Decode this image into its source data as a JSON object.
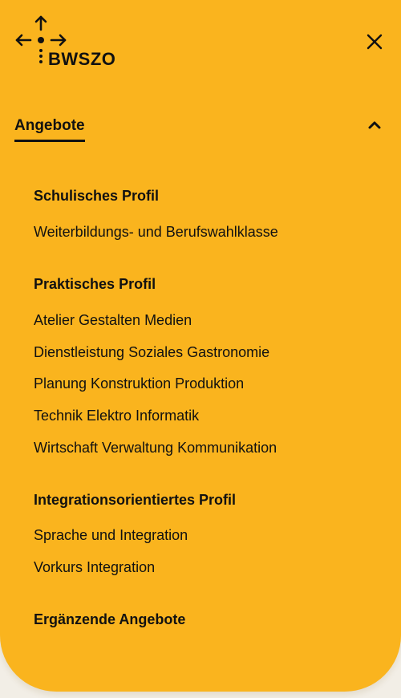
{
  "header": {
    "logo_text": "BWSZO"
  },
  "menu": {
    "section_title": "Angebote",
    "groups": [
      {
        "heading": "Schulisches Profil",
        "links": [
          "Weiterbildungs- und Berufswahlklasse"
        ]
      },
      {
        "heading": "Praktisches Profil",
        "links": [
          "Atelier Gestalten Medien",
          "Dienstleistung Soziales Gastronomie",
          "Planung Konstruktion Produktion",
          "Technik Elektro Informatik",
          "Wirtschaft Verwaltung Kommunikation"
        ]
      },
      {
        "heading": "Integrationsorientiertes Profil",
        "links": [
          "Sprache und Integration",
          "Vorkurs Integration"
        ]
      },
      {
        "heading": "Ergänzende Angebote",
        "links": []
      }
    ]
  },
  "icons": {
    "logo": "compass-arrows-icon",
    "close": "close-icon",
    "collapse": "chevron-up-icon"
  },
  "colors": {
    "background": "#fab41e",
    "text": "#111111"
  }
}
